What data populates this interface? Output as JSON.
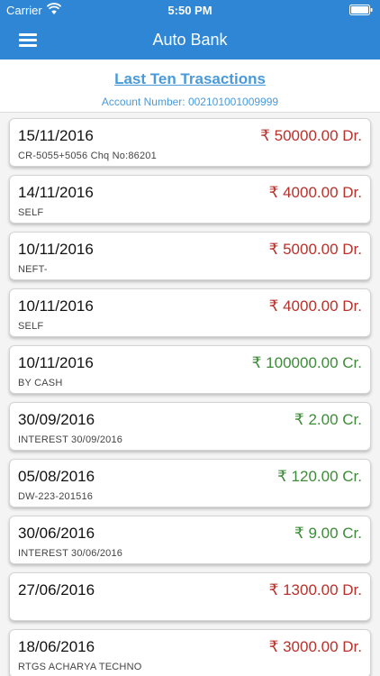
{
  "status_bar": {
    "carrier": "Carrier",
    "time": "5:50 PM"
  },
  "nav": {
    "title": "Auto Bank",
    "menu_icon": "hamburger-menu-icon"
  },
  "header": {
    "title": "Last Ten Trasactions",
    "account_number": "Account Number: 002101001009999"
  },
  "colors": {
    "brand": "#2f86d4",
    "debit": "#b8312a",
    "credit": "#3d8b38",
    "link": "#4a9ad9"
  },
  "transactions": [
    {
      "date": "15/11/2016",
      "description": "CR-5055+5056 Chq No:86201",
      "amount": "₹ 50000.00 Dr.",
      "type": "dr"
    },
    {
      "date": "14/11/2016",
      "description": "SELF",
      "amount": "₹ 4000.00 Dr.",
      "type": "dr"
    },
    {
      "date": "10/11/2016",
      "description": "NEFT-",
      "amount": "₹ 5000.00 Dr.",
      "type": "dr"
    },
    {
      "date": "10/11/2016",
      "description": "SELF",
      "amount": "₹ 4000.00 Dr.",
      "type": "dr"
    },
    {
      "date": "10/11/2016",
      "description": "BY CASH",
      "amount": "₹ 100000.00 Cr.",
      "type": "cr"
    },
    {
      "date": "30/09/2016",
      "description": "INTEREST 30/09/2016",
      "amount": "₹ 2.00 Cr.",
      "type": "cr"
    },
    {
      "date": "05/08/2016",
      "description": "DW-223-201516",
      "amount": "₹ 120.00 Cr.",
      "type": "cr"
    },
    {
      "date": "30/06/2016",
      "description": "INTEREST 30/06/2016",
      "amount": "₹ 9.00 Cr.",
      "type": "cr"
    },
    {
      "date": "27/06/2016",
      "description": "",
      "amount": "₹ 1300.00 Dr.",
      "type": "dr"
    },
    {
      "date": "18/06/2016",
      "description": "RTGS ACHARYA TECHNO",
      "amount": "₹ 3000.00 Dr.",
      "type": "dr"
    }
  ]
}
